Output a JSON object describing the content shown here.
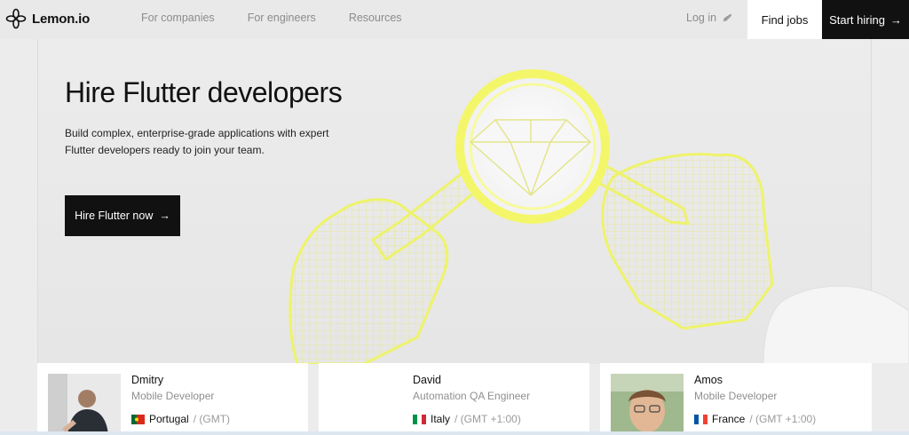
{
  "brand": {
    "name": "Lemon.io",
    "icon": "lemon-logo-icon"
  },
  "nav": {
    "items": [
      "For companies",
      "For engineers",
      "Resources"
    ],
    "login_label": "Log in",
    "find_jobs_label": "Find jobs",
    "start_hiring_label": "Start hiring"
  },
  "hero": {
    "title": "Hire Flutter developers",
    "subtitle": "Build complex, enterprise-grade applications with expert Flutter developers ready to join your team.",
    "cta_label": "Hire Flutter now"
  },
  "developers": [
    {
      "name": "Dmitry",
      "role": "Mobile Developer",
      "country": "Portugal",
      "timezone": "/ (GMT)",
      "flag": "portugal-flag-icon"
    },
    {
      "name": "David",
      "role": "Automation QA Engineer",
      "country": "Italy",
      "timezone": "/ (GMT +1:00)",
      "flag": "italy-flag-icon"
    },
    {
      "name": "Amos",
      "role": "Mobile Developer",
      "country": "France",
      "timezone": "/ (GMT +1:00)",
      "flag": "france-flag-icon"
    }
  ],
  "colors": {
    "primary": "#111111",
    "accent": "#f3f37a",
    "muted": "#8c8c8c"
  }
}
